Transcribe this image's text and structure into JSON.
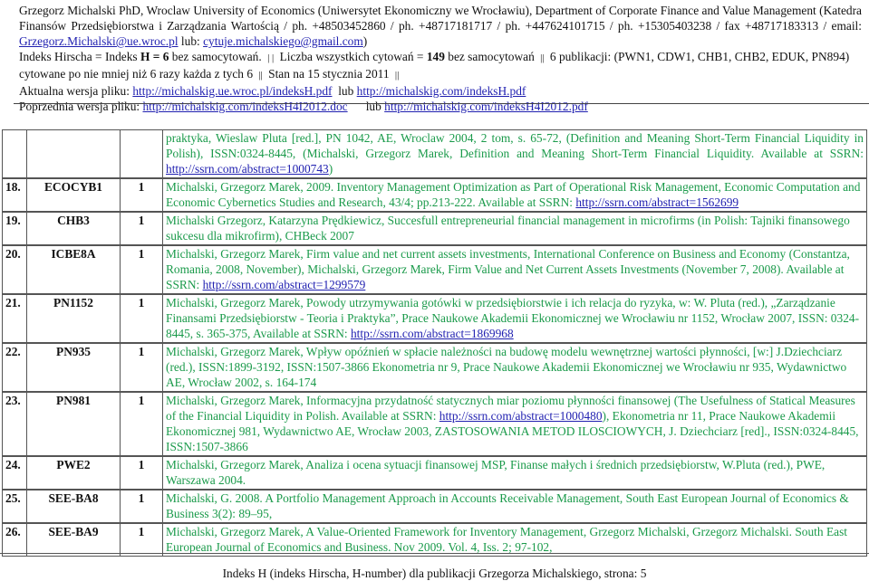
{
  "header": {
    "line1": "Grzegorz Michalski PhD, Wroclaw University of Economics (Uniwersytet Ekonomiczny we Wrocławiu), Department of Corporate Finance and Value Management (Katedra",
    "line2": "Finansów Przedsiębiorstwa i Zarządzania Wartością / ph. +48503452860 / ph. +48717181717 / ph. +447624101715 / ph. +15305403238 / fax +48717183313 / email:",
    "email_primary": "Grzegorz.Michalski@ue.wroc.pl",
    "email_sep": " lub: ",
    "email_secondary": "cytuje.michalskiego@gmail.com",
    "email_close": ")",
    "hindex_prefix": "Indeks Hirscha = Indeks ",
    "hindex_value": "H = 6",
    "hindex_suffix": " bez samocytowań.",
    "sep1": "| |",
    "citations_prefix": " Liczba wszystkich cytowań = ",
    "citations_value": "149",
    "citations_suffix": " bez samocytowań ",
    "sep2": "||",
    "publications_text": " 6 publikacji: (PWN1, CDW1, CHB1, CHB2, EDUK, PN894)",
    "line5_text": "cytowane po nie mniej niż 6 razy każda z tych 6 ",
    "sep3": "||",
    "line5_status": " Stan na 15 stycznia 2011 ",
    "sep4": "||",
    "current_label": "Aktualna wersja pliku: ",
    "current_link1": "http://michalskig.ue.wroc.pl/indeksH.pdf",
    "current_or": "  lub ",
    "current_link2": "http://michalskig.com/indeksH.pdf",
    "previous_label": "Poprzednia wersja pliku: ",
    "previous_link1": "http://michalskig.com/indeksH4I2012.doc",
    "previous_or": "      lub ",
    "previous_link2": "http://michalskig.com/indeksH4I2012.pdf"
  },
  "table": {
    "continuation": {
      "text": "praktyka, Wieslaw Pluta [red.], PN 1042, AE, Wroclaw 2004, 2 tom, s. 65-72, (Definition and Meaning Short-Term Financial Liquidity in Polish), ISSN:0324-8445, (Michalski, Grzegorz Marek, Definition and Meaning Short-Term Financial Liquidity. Available at SSRN: ",
      "link": "http://ssrn.com/abstract=1000743",
      "after": ")"
    },
    "rows": [
      {
        "num": "18.",
        "code": "ECOCYB1",
        "count": "1",
        "text": "Michalski, Grzegorz Marek, 2009. Inventory Management Optimization as Part of Operational Risk Management, Economic Computation and Economic Cybernetics Studies and Research, 43/4; pp.213-222. Available at SSRN: ",
        "link": "http://ssrn.com/abstract=1562699",
        "after": ""
      },
      {
        "num": "19.",
        "code": "CHB3",
        "count": "1",
        "text": "Michalski Grzegorz, Katarzyna Prędkiewicz, Succesfull entrepreneurial financial management in microfirms (in Polish: Tajniki finansowego sukcesu dla mikrofirm), CHBeck 2007",
        "link": "",
        "after": ""
      },
      {
        "num": "20.",
        "code": "ICBE8A",
        "count": "1",
        "text": "Michalski, Grzegorz Marek, Firm value and net current assets investments, International Conference on Business and Economy (Constantza, Romania, 2008, November), Michalski, Grzegorz Marek, Firm Value and Net Current Assets Investments (November 7, 2008). Available at SSRN: ",
        "link": "http://ssrn.com/abstract=1299579",
        "after": ""
      },
      {
        "num": "21.",
        "code": "PN1152",
        "count": "1",
        "text": "Michalski, Grzegorz Marek, Powody utrzymywania gotówki w przedsiębiorstwie i ich  relacja do ryzyka, w: W. Pluta (red.), „Zarządzanie Finansami Przedsiębiorstw - Teoria i  Praktyka”, Prace Naukowe Akademii Ekonomicznej we Wrocławiu nr 1152, Wrocław 2007, ISSN: 0324-8445, s. 365-375, Available at SSRN: ",
        "link": "http://ssrn.com/abstract=1869968",
        "after": ""
      },
      {
        "num": "22.",
        "code": "PN935",
        "count": "1",
        "text": "Michalski, Grzegorz Marek, Wpływ opóźnień w spłacie należności na budowę modelu wewnętrznej wartości płynności, [w:] J.Dziechciarz (red.), ISSN:1899-3192, ISSN:1507-3866 Ekonometria nr 9, Prace Naukowe Akademii Ekonomicznej we Wrocławiu nr 935, Wydawnictwo AE, Wrocław 2002, s. 164-174",
        "link": "",
        "after": ""
      },
      {
        "num": "23.",
        "code": "PN981",
        "count": "1",
        "text": "Michalski, Grzegorz Marek, Informacyjna przydatność statycznych miar poziomu płynności finansowej (The Usefulness of Statical Measures of the Financial Liquidity in Polish. Available at SSRN: ",
        "link": "http://ssrn.com/abstract=1000480",
        "after": "), Ekonometria nr 11, Prace Naukowe Akademii Ekonomicznej 981, Wydawnictwo AE, Wrocław 2003, ZASTOSOWANIA METOD ILOSCIOWYCH, J. Dziechciarz [red]., ISSN:0324-8445, ISSN:1507-3866"
      },
      {
        "num": "24.",
        "code": "PWE2",
        "count": "1",
        "text": "Michalski, Grzegorz Marek, Analiza i ocena sytuacji finansowej MSP, Finanse małych i średnich przedsiębiorstw, W.Pluta (red.), PWE, Warszawa 2004.",
        "link": "",
        "after": ""
      },
      {
        "num": "25.",
        "code": "SEE-BA8",
        "count": "1",
        "text": "Michalski, G. 2008. A Portfolio Management Approach in Accounts Receivable Management, South East European Journal of Economics & Business  3(2): 89–95,",
        "link": "",
        "after": ""
      },
      {
        "num": "26.",
        "code": "SEE-BA9",
        "count": "1",
        "text": "Michalski, Grzegorz Marek, A Value-Oriented Framework for Inventory Management, Grzegorz Michalski, Grzegorz Michalski. South East European Journal of Economics and Business. Nov 2009. Vol. 4, Iss. 2; 97-102,",
        "link": "",
        "after": ""
      }
    ]
  },
  "footer": {
    "text": "Indeks H (indeks Hirscha, H-number) dla publikacji Grzegorza Michalskiego, strona: 5"
  }
}
